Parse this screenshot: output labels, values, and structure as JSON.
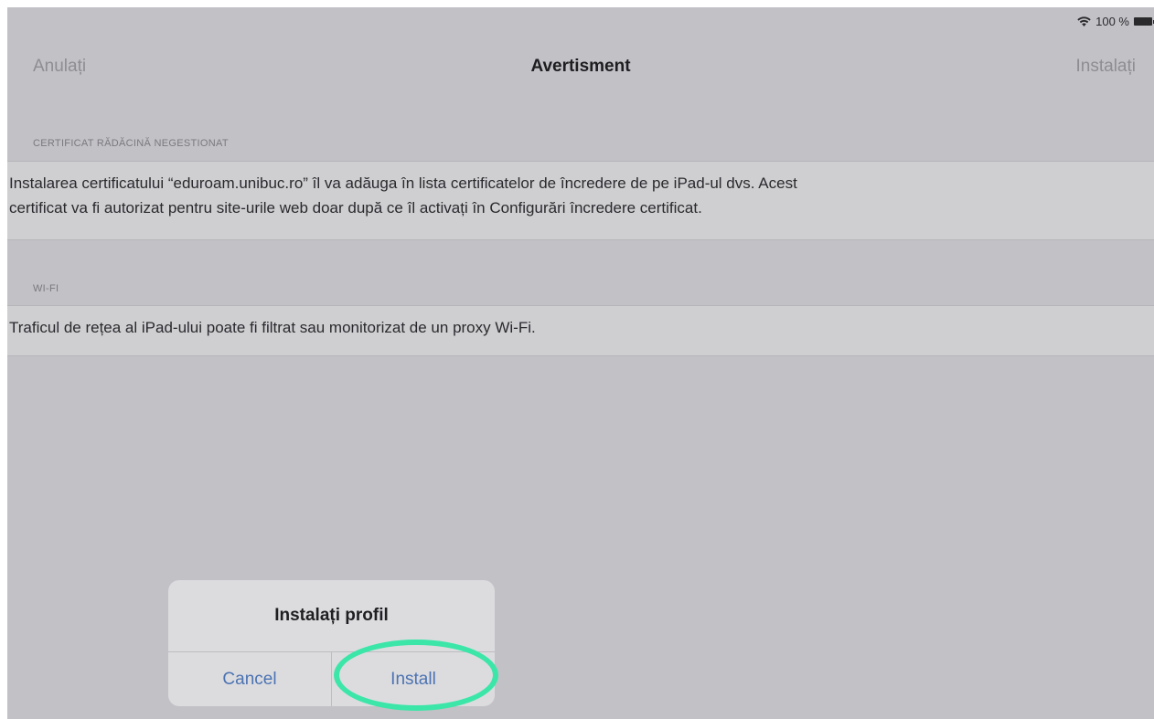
{
  "status_bar": {
    "battery_text": "100 %"
  },
  "nav": {
    "left_button": "Anulați",
    "title": "Avertisment",
    "right_button": "Instalați"
  },
  "sections": [
    {
      "header": "CERTIFICAT RĂDĂCINĂ NEGESTIONAT",
      "text_line1": "Instalarea certificatului “eduroam.unibuc.ro” îl va adăuga în lista certificatelor de încredere de pe iPad-ul dvs. Acest",
      "text_line2": "certificat va fi autorizat pentru site-urile web doar după ce îl activați în Configurări încredere certificat."
    },
    {
      "header": "WI-FI",
      "text_line1": "Traficul de rețea al iPad-ului poate fi filtrat sau monitorizat de un proxy Wi-Fi."
    }
  ],
  "dialog": {
    "title": "Instalați profil",
    "cancel_label": "Cancel",
    "install_label": "Install"
  },
  "colors": {
    "highlight": "#3be6a8",
    "button_text": "#4c73b2"
  }
}
